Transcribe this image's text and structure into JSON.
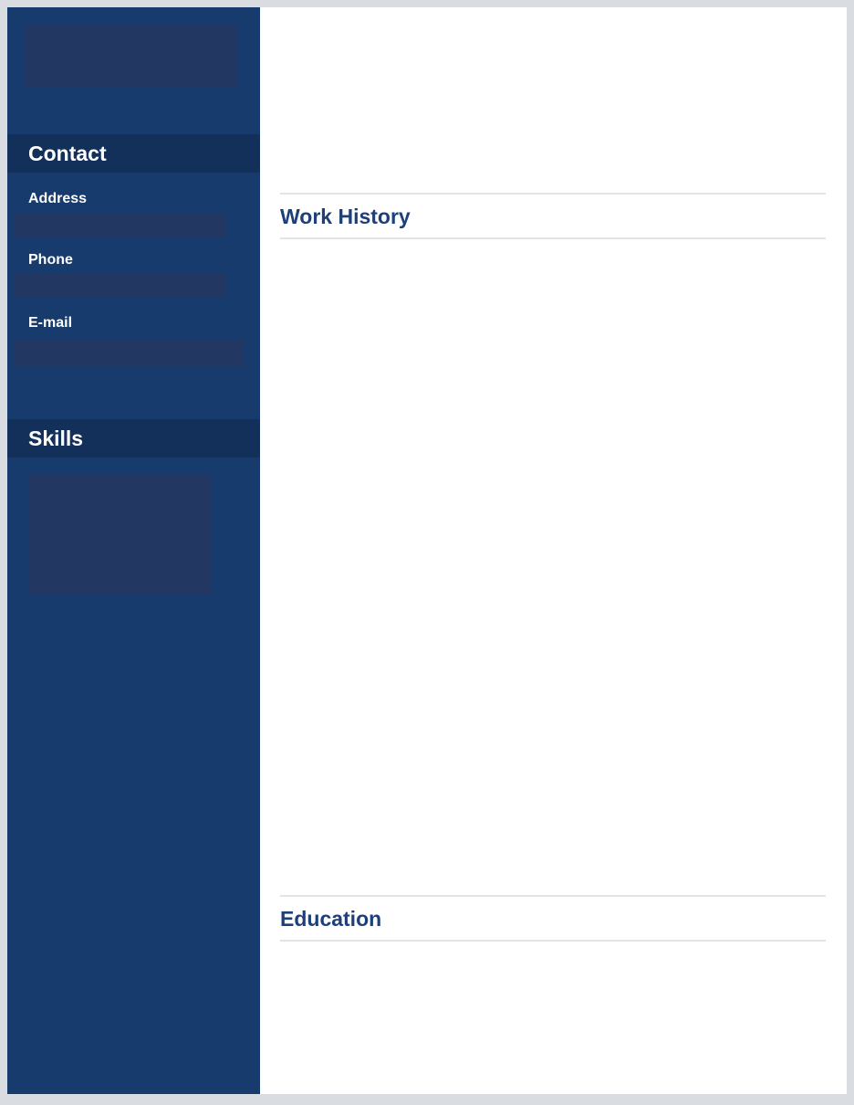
{
  "sidebar": {
    "contact": {
      "heading": "Contact",
      "address_label": "Address",
      "phone_label": "Phone",
      "email_label": "E-mail"
    },
    "skills": {
      "heading": "Skills"
    }
  },
  "main": {
    "work_history_heading": "Work History",
    "education_heading": "Education"
  },
  "colors": {
    "sidebar_bg": "#183b6e",
    "section_bar_bg": "#13305a",
    "heading_blue": "#1e3f78",
    "redaction": "#223862"
  }
}
